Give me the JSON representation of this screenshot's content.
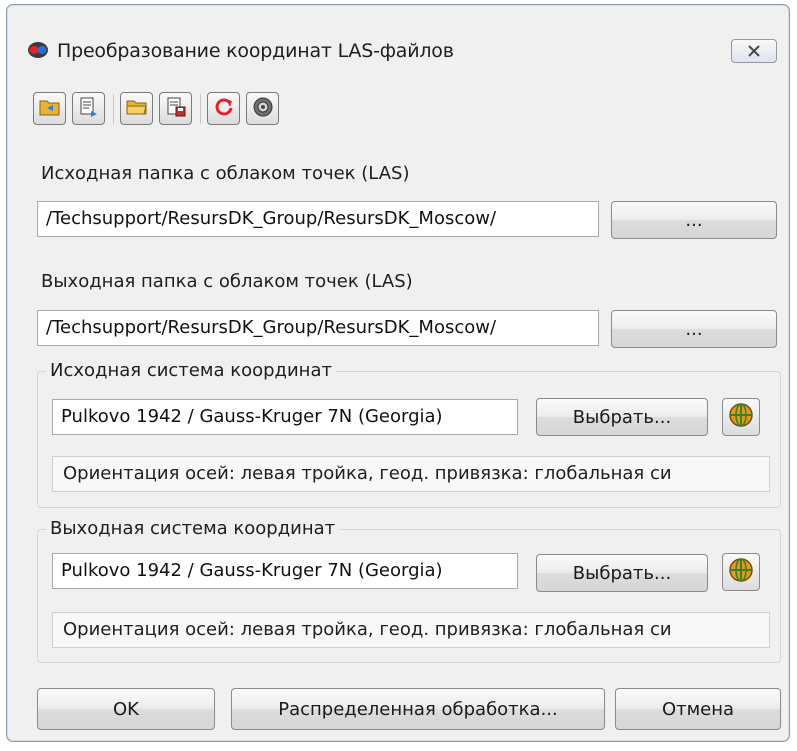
{
  "window": {
    "title": "Преобразование координат LAS-файлов",
    "close_icon": "close-icon"
  },
  "toolbar": {
    "buttons": [
      {
        "name": "open-settings-icon"
      },
      {
        "name": "save-settings-icon"
      },
      {
        "name": "open-folder-icon"
      },
      {
        "name": "save-file-icon"
      },
      {
        "name": "refresh-icon"
      },
      {
        "name": "settings-gear-icon"
      }
    ]
  },
  "input_folder": {
    "label": "Исходная папка с облаком точек (LAS)",
    "value": "/Techsupport/ResursDK_Group/ResursDK_Moscow/",
    "browse_label": "..."
  },
  "output_folder": {
    "label": "Выходная папка с облаком точек (LAS)",
    "value": "/Techsupport/ResursDK_Group/ResursDK_Moscow/",
    "browse_label": "..."
  },
  "source_cs": {
    "title": "Исходная система координат",
    "value": "Pulkovo 1942 / Gauss-Kruger 7N (Georgia)",
    "select_label": "Выбрать...",
    "info": "Ориентация осей: левая тройка, геод. привязка: глобальная си"
  },
  "target_cs": {
    "title": "Выходная система координат",
    "value": "Pulkovo 1942 / Gauss-Kruger 7N (Georgia)",
    "select_label": "Выбрать...",
    "info": "Ориентация осей: левая тройка, геод. привязка: глобальная си"
  },
  "footer": {
    "ok_label": "OK",
    "distributed_label": "Распределенная обработка...",
    "cancel_label": "Отмена"
  }
}
